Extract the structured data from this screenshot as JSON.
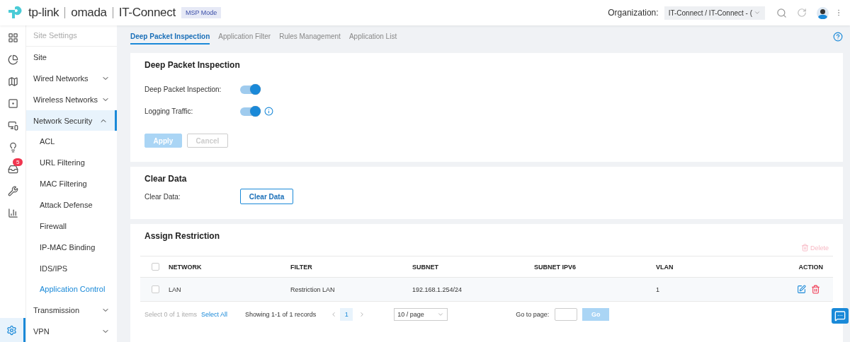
{
  "header": {
    "brand": "tp-link",
    "product": "omada",
    "site": "IT-Connect",
    "mode_badge": "MSP Mode",
    "org_label": "Organization:",
    "org_value": "IT-Connect / IT-Connect - ("
  },
  "rail": [
    {
      "kind": "dashboard",
      "selected": false
    },
    {
      "kind": "stats",
      "selected": false
    },
    {
      "kind": "map",
      "selected": false
    },
    {
      "kind": "devices",
      "selected": false
    },
    {
      "kind": "clients",
      "selected": false
    },
    {
      "kind": "insight",
      "selected": false
    },
    {
      "kind": "logs",
      "selected": false,
      "badge": "5"
    },
    {
      "kind": "tools",
      "selected": false
    },
    {
      "kind": "reports",
      "selected": false
    },
    {
      "kind": "settings",
      "selected": true
    }
  ],
  "sidebar": {
    "title": "Site Settings",
    "items": [
      {
        "label": "Site",
        "selected": false
      },
      {
        "label": "Wired Networks",
        "selected": false,
        "expanded": false
      },
      {
        "label": "Wireless Networks",
        "selected": false,
        "expanded": false
      },
      {
        "label": "Network Security",
        "selected": false,
        "expanded": true,
        "children": [
          {
            "label": "ACL",
            "selected": false
          },
          {
            "label": "URL Filtering",
            "selected": false
          },
          {
            "label": "MAC Filtering",
            "selected": false
          },
          {
            "label": "Attack Defense",
            "selected": false
          },
          {
            "label": "Firewall",
            "selected": false
          },
          {
            "label": "IP-MAC Binding",
            "selected": false
          },
          {
            "label": "IDS/IPS",
            "selected": false
          },
          {
            "label": "Application Control",
            "selected": true
          }
        ]
      },
      {
        "label": "Transmission",
        "selected": false,
        "expanded": false
      },
      {
        "label": "VPN",
        "selected": false,
        "expanded": false
      }
    ]
  },
  "tabs": [
    {
      "label": "Deep Packet Inspection",
      "selected": true
    },
    {
      "label": "Application Filter",
      "selected": false
    },
    {
      "label": "Rules Management",
      "selected": false
    },
    {
      "label": "Application List",
      "selected": false
    }
  ],
  "dpi": {
    "title": "Deep Packet Inspection",
    "settings": [
      {
        "label": "Deep Packet Inspection:",
        "on": true,
        "info": false
      },
      {
        "label": "Logging Traffic:",
        "on": true,
        "info": true
      }
    ],
    "apply": {
      "label": "Apply",
      "disabled": true
    },
    "cancel": {
      "label": "Cancel",
      "disabled": true
    }
  },
  "clear": {
    "title": "Clear Data",
    "label": "Clear Data:",
    "button": "Clear Data"
  },
  "restriction": {
    "title": "Assign Restriction",
    "delete": {
      "label": "Delete",
      "disabled": true
    },
    "all_checked": false,
    "columns": [
      "NETWORK",
      "FILTER",
      "SUBNET",
      "SUBNET IPV6",
      "VLAN",
      "ACTION"
    ],
    "rows": [
      {
        "checked": false,
        "cells": [
          "LAN",
          "Restriction LAN",
          "192.168.1.254/24",
          "",
          "1"
        ]
      }
    ],
    "footer": {
      "selection": "Select 0 of 1 items",
      "select_all": "Select All",
      "showing": "Showing 1-1 of 1 records",
      "page": "1",
      "page_size": "10 / page",
      "goto_label": "Go to page:",
      "go": "Go"
    }
  }
}
